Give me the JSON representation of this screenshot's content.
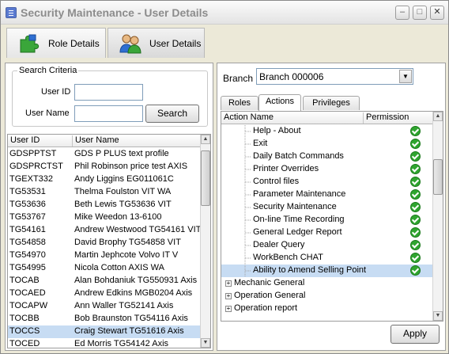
{
  "window": {
    "title": "Security Maintenance - User Details",
    "min": "–",
    "max": "□",
    "close": "✕"
  },
  "top_tabs": [
    {
      "label": "Role Details",
      "icon": "puzzle-icon"
    },
    {
      "label": "User Details",
      "icon": "users-icon"
    }
  ],
  "search": {
    "group_title": "Search Criteria",
    "user_id_label": "User ID",
    "user_id_value": "",
    "user_name_label": "User Name",
    "user_name_value": "",
    "button": "Search"
  },
  "users_grid": {
    "columns": [
      "User ID",
      "User Name"
    ],
    "rows": [
      [
        "GDSPPTST",
        "GDS P PLUS text profile"
      ],
      [
        "GDSPRCTST",
        "Phil Robinson price test AXIS"
      ],
      [
        "TGEXT332",
        "Andy Liggins                 EG011061C"
      ],
      [
        "TG53531",
        "Thelma Foulston          VIT     WA"
      ],
      [
        "TG53636",
        "Beth Lewis       TG53636  VIT"
      ],
      [
        "TG53767",
        "Mike Weedon                 13-6100"
      ],
      [
        "TG54161",
        "Andrew Westwood TG54161  VIT"
      ],
      [
        "TG54858",
        "David Brophy     TG54858  VIT"
      ],
      [
        "TG54970",
        "Martin Jephcote               Volvo IT  V"
      ],
      [
        "TG54995",
        "Nicola Cotton              AXIS     WA"
      ],
      [
        "TOCAB",
        "Alan Bohdaniuk  TG550931  Axis"
      ],
      [
        "TOCAED",
        "Andrew Edkins   MGB0204  Axis"
      ],
      [
        "TOCAPW",
        "Ann Waller      TG52141  Axis"
      ],
      [
        "TOCBB",
        "Bob Braunston   TG54116  Axis"
      ],
      [
        "TOCCS",
        "Craig Stewart   TG51616  Axis"
      ],
      [
        "TOCED",
        "Ed Morris       TG54142  Axis"
      ]
    ],
    "selected_index": 14
  },
  "branch": {
    "label": "Branch",
    "value": "Branch 000006"
  },
  "inner_tabs": [
    "Roles",
    "Actions",
    "Privileges"
  ],
  "actions_tree": {
    "columns": [
      "Action Name",
      "Permission"
    ],
    "rows": [
      {
        "label": "Help - About",
        "check": true,
        "type": "leaf"
      },
      {
        "label": "Exit",
        "check": true,
        "type": "leaf"
      },
      {
        "label": "Daily Batch Commands",
        "check": true,
        "type": "leaf"
      },
      {
        "label": "Printer Overrides",
        "check": true,
        "type": "leaf"
      },
      {
        "label": "Control files",
        "check": true,
        "type": "leaf"
      },
      {
        "label": "Parameter Maintenance",
        "check": true,
        "type": "leaf"
      },
      {
        "label": "Security Maintenance",
        "check": true,
        "type": "leaf"
      },
      {
        "label": "On-line Time Recording",
        "check": true,
        "type": "leaf"
      },
      {
        "label": "General Ledger Report",
        "check": true,
        "type": "leaf"
      },
      {
        "label": "Dealer Query",
        "check": true,
        "type": "leaf"
      },
      {
        "label": "WorkBench CHAT",
        "check": true,
        "type": "leaf"
      },
      {
        "label": "Ability to Amend Selling Point",
        "check": true,
        "type": "leaf",
        "selected": true
      },
      {
        "label": "Mechanic General",
        "check": false,
        "type": "group"
      },
      {
        "label": "Operation General",
        "check": false,
        "type": "group"
      },
      {
        "label": "Operation report",
        "check": false,
        "type": "group"
      }
    ]
  },
  "apply_button": "Apply",
  "colors": {
    "check": "#2fa52f",
    "selection": "#c7dcf3",
    "window_bg": "#ece9d8"
  }
}
